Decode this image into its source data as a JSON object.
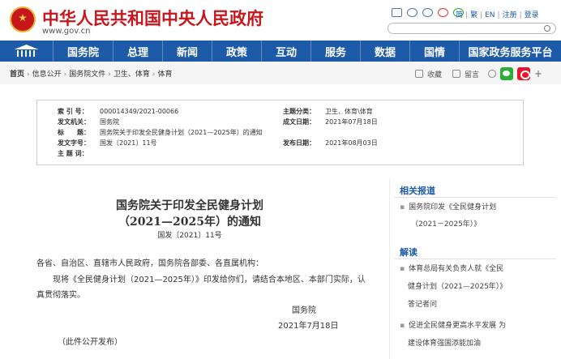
{
  "header": {
    "site_title": "中华人民共和国中央人民政府",
    "site_url": "www.gov.cn",
    "links": [
      "简",
      "繁",
      "EN",
      "注册",
      "登录"
    ],
    "search_placeholder": ""
  },
  "nav": {
    "items": [
      "国务院",
      "总理",
      "新闻",
      "政策",
      "互动",
      "服务",
      "数据",
      "国情",
      "国家政务服务平台"
    ]
  },
  "breadcrumb": {
    "items": [
      "首页",
      "信息公开",
      "国务院文件",
      "卫生、体育",
      "体育"
    ],
    "favorite": "收藏",
    "print": "留言"
  },
  "info": {
    "index_key": "索 引 号：",
    "index_val": "000014349/2021-00066",
    "issuer_key": "发文机关：",
    "issuer_val": "国务院",
    "title_key": "标　　题：",
    "title_val": "国务院关于印发全民健身计划（2021—2025年）的通知",
    "docno_key": "发文字号：",
    "docno_val": "国发〔2021〕11号",
    "topic_key": "主 题 词：",
    "topic_val": "",
    "category_key": "主题分类：",
    "category_val": "卫生、体育\\体育",
    "written_key": "成文日期：",
    "written_val": "2021年07月18日",
    "published_key": "发布日期：",
    "published_val": "2021年08月03日"
  },
  "article": {
    "title_line1": "国务院关于印发全民健身计划",
    "title_line2": "（2021—2025年）的通知",
    "doc_number": "国发〔2021〕11号",
    "salutation": "各省、自治区、直辖市人民政府，国务院各部委、各直属机构：",
    "body_line1": "现将《全民健身计划（2021—2025年）》印发给你们，请结合本地区、本部门实际，认",
    "body_line2": "真贯彻落实。",
    "signature": "国务院",
    "sign_date": "2021年7月18日",
    "note": "（此件公开发布）"
  },
  "sidebar": {
    "related_title": "相关报道",
    "related_item_line1": "国务院印发《全民健身计划",
    "related_item_line2": "（2021－2025年）》",
    "interpret_title": "解读",
    "interpret_item1_line1": "体育总局有关负责人就《全民",
    "interpret_item1_line2": "健身计划（2021—2025年）》",
    "interpret_item1_line3": "答记者问",
    "interpret_item2_line1": "促进全民健身更高水平发展 为",
    "interpret_item2_line2": "建设体育强国添能加油"
  },
  "colors": {
    "brand_red": "#c8161d",
    "nav_blue": "#1d5aa8"
  }
}
